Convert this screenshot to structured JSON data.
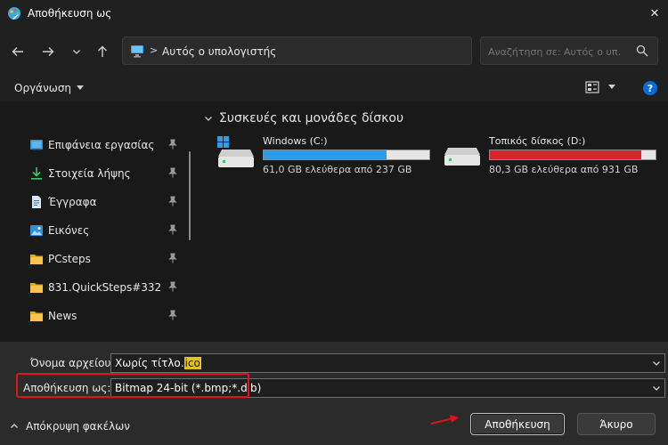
{
  "window": {
    "title": "Αποθήκευση ως",
    "close_glyph": "✕"
  },
  "address": {
    "separator": ">",
    "path": "Αυτός ο υπολογιστής"
  },
  "search": {
    "placeholder": "Αναζήτηση σε: Αυτός ο υπ..."
  },
  "toolbar": {
    "organize_label": "Οργάνωση",
    "help_label": "?"
  },
  "sidebar": {
    "items": [
      {
        "label": "Επιφάνεια εργασίας",
        "icon": "desktop-icon"
      },
      {
        "label": "Στοιχεία λήψης",
        "icon": "download-icon"
      },
      {
        "label": "Έγγραφα",
        "icon": "document-icon"
      },
      {
        "label": "Εικόνες",
        "icon": "pictures-icon"
      },
      {
        "label": "PCsteps",
        "icon": "folder-icon"
      },
      {
        "label": "831.QuickSteps#332",
        "icon": "folder-icon"
      },
      {
        "label": "News",
        "icon": "folder-icon"
      }
    ]
  },
  "main": {
    "group_title": "Συσκευές και μονάδες δίσκου",
    "drives": [
      {
        "name": "Windows (C:)",
        "free_text": "61,0 GB ελεύθερα από 237 GB",
        "used_fraction": 0.743,
        "bar_color": "#2f9be6"
      },
      {
        "name": "Τοπικός δίσκος (D:)",
        "free_text": "80,3 GB ελεύθερα από 931 GB",
        "used_fraction": 0.914,
        "bar_color": "#d9262e"
      }
    ]
  },
  "form": {
    "filename_label": "Όνομα αρχείου:",
    "filename_prefix": "Χωρίς τίτλο.",
    "filename_selected": "ico",
    "savetype_label": "Αποθήκευση ως:",
    "savetype_value": "Bitmap 24-bit (*.bmp;*.dib)"
  },
  "footer": {
    "hide_folders_label": "Απόκρυψη φακέλων",
    "save_label": "Αποθήκευση",
    "cancel_label": "Άκυρο"
  },
  "colors": {
    "accent": "#0a6bd6",
    "highlight": "#e0131a",
    "selection": "#e4c21a"
  }
}
